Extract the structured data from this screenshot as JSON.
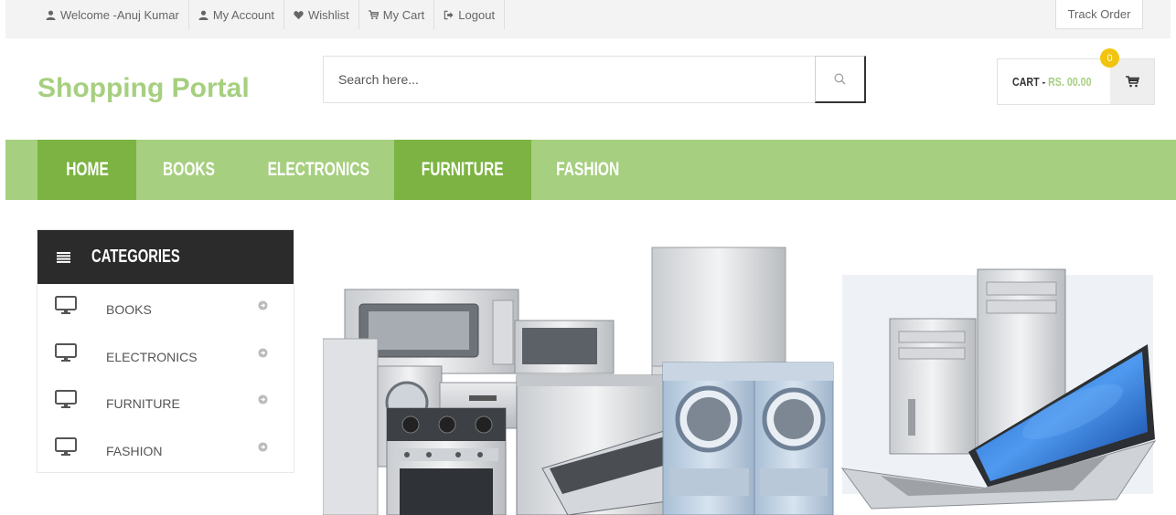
{
  "topbar": {
    "links": [
      {
        "label": "Welcome -Anuj Kumar",
        "icon": "user-icon"
      },
      {
        "label": "My Account",
        "icon": "user-icon"
      },
      {
        "label": "Wishlist",
        "icon": "heart-icon"
      },
      {
        "label": "My Cart",
        "icon": "cart-icon"
      },
      {
        "label": "Logout",
        "icon": "logout-icon"
      }
    ],
    "track_order": "Track Order"
  },
  "header": {
    "logo": "Shopping Portal",
    "search_placeholder": "Search here...",
    "cart_label": "CART -",
    "cart_amount": "RS. 00.00",
    "cart_count": "0"
  },
  "nav": {
    "items": [
      {
        "label": "HOME",
        "active": true
      },
      {
        "label": "BOOKS",
        "active": false
      },
      {
        "label": "ELECTRONICS",
        "active": false
      },
      {
        "label": "FURNITURE",
        "active": true
      },
      {
        "label": "FASHION",
        "active": false
      }
    ]
  },
  "sidebar": {
    "title": "CATEGORIES",
    "items": [
      {
        "label": "BOOKS"
      },
      {
        "label": "ELECTRONICS"
      },
      {
        "label": "FURNITURE"
      },
      {
        "label": "FASHION"
      }
    ]
  },
  "banner": {
    "image": "home-appliances-and-computers"
  },
  "colors": {
    "brand_green": "#a6cf7f",
    "nav_active": "#7cb342",
    "badge": "#f1c40f",
    "dark": "#2b2b2b"
  }
}
